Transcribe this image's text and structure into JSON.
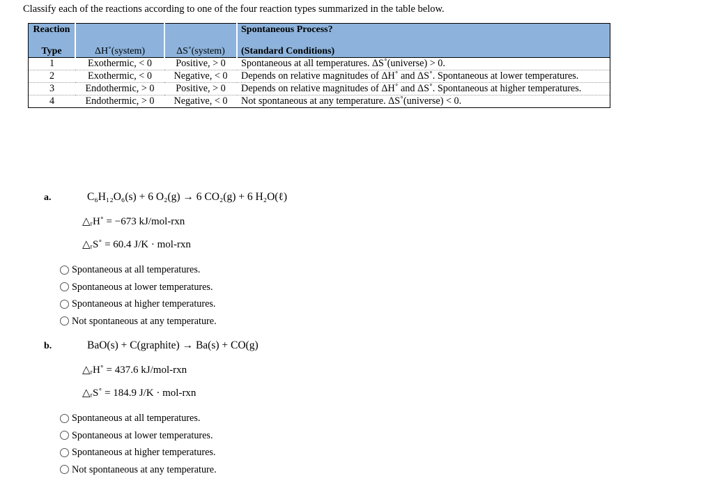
{
  "intro": "Classify each of the reactions according to one of the four reaction types summarized in the table below.",
  "table": {
    "headers": {
      "col1_line1": "Reaction",
      "col1_line2": "Type",
      "col2": "ΔH˚(system)",
      "col3": "ΔS˚(system)",
      "col4_line1": "Spontaneous Process?",
      "col4_line2": "(Standard Conditions)"
    },
    "rows": [
      {
        "num": "1",
        "dh": "Exothermic, < 0",
        "ds": "Positive, > 0",
        "desc": "Spontaneous at all temperatures.  ΔS˚(universe) > 0."
      },
      {
        "num": "2",
        "dh": "Exothermic, < 0",
        "ds": "Negative, < 0",
        "desc": "Depends on relative magnitudes of ΔH˚ and ΔS˚. Spontaneous at lower temperatures."
      },
      {
        "num": "3",
        "dh": "Endothermic, > 0",
        "ds": "Positive, > 0",
        "desc": "Depends on relative magnitudes of ΔH˚ and ΔS˚. Spontaneous at higher temperatures."
      },
      {
        "num": "4",
        "dh": "Endothermic, > 0",
        "ds": "Negative, < 0",
        "desc": "Not spontaneous at any temperature.  ΔS˚(universe) < 0."
      }
    ]
  },
  "questions": [
    {
      "label": "a.",
      "equation": "C₆H₁₂O₆(s) + 6 O₂(g) → 6 CO₂(g) + 6 H₂O(ℓ)",
      "delta_h": "△ᵣH˚ = −673 kJ/mol-rxn",
      "delta_s": "△ᵣS˚ = 60.4 J/K · mol-rxn",
      "options": [
        "Spontaneous at all temperatures.",
        "Spontaneous at lower temperatures.",
        "Spontaneous at higher temperatures.",
        "Not spontaneous at any temperature."
      ]
    },
    {
      "label": "b.",
      "equation": "BaO(s) + C(graphite) → Ba(s) + CO(g)",
      "delta_h": "△ᵣH˚ = 437.6 kJ/mol-rxn",
      "delta_s": "△ᵣS˚ = 184.9 J/K · mol-rxn",
      "options": [
        "Spontaneous at all temperatures.",
        "Spontaneous at lower temperatures.",
        "Spontaneous at higher temperatures.",
        "Not spontaneous at any temperature."
      ]
    }
  ],
  "colors": {
    "header_blue": "#8db3dc",
    "table_border": "#000000",
    "row_divider": "#9a9a9a"
  }
}
